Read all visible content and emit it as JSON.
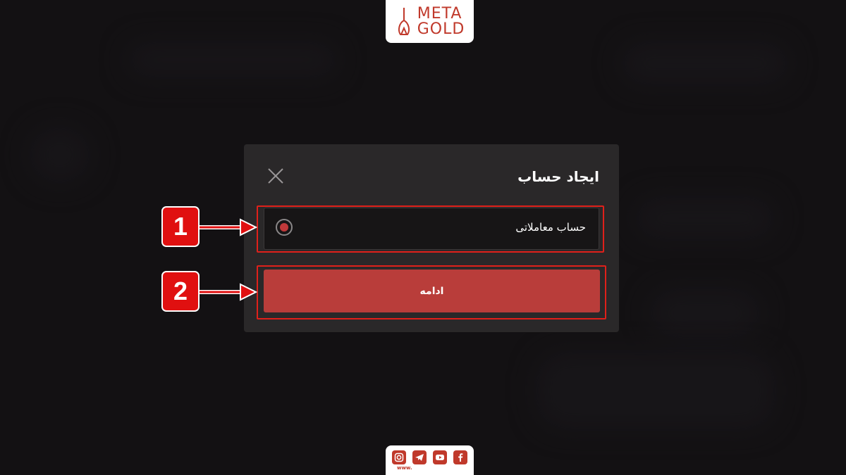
{
  "logo": {
    "line1": "META",
    "line2": "GOLD"
  },
  "modal": {
    "title": "ایجاد حساب",
    "option_label": "حساب معاملاتی",
    "continue_label": "ادامه"
  },
  "steps": {
    "one": "1",
    "two": "2"
  },
  "social": {
    "icons": [
      "instagram-icon",
      "telegram-icon",
      "youtube-icon",
      "facebook-icon"
    ],
    "url_prefix": "www."
  },
  "colors": {
    "accent": "#b93d3a",
    "highlight": "#e0201a",
    "badge": "#e01010",
    "modal_bg": "#2a2829",
    "page_bg": "#1a181a"
  }
}
